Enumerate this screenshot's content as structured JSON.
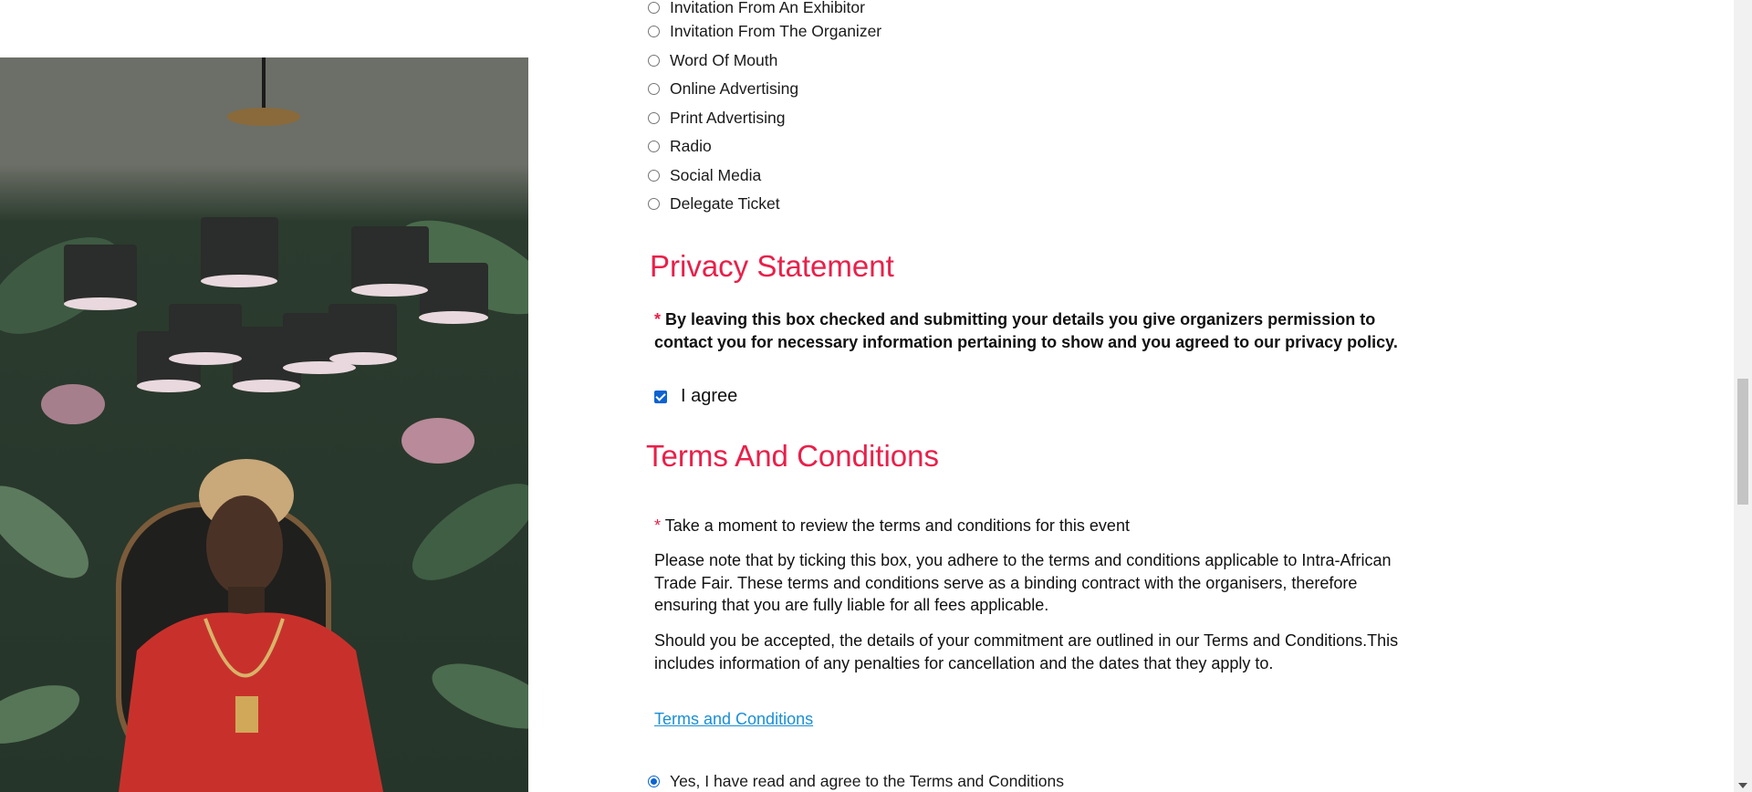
{
  "survey": {
    "options": [
      {
        "label": "Invitation From An Exhibitor",
        "checked": false
      },
      {
        "label": "Invitation From The Organizer",
        "checked": false
      },
      {
        "label": "Word Of Mouth",
        "checked": false
      },
      {
        "label": "Online Advertising",
        "checked": false
      },
      {
        "label": "Print Advertising",
        "checked": false
      },
      {
        "label": "Radio",
        "checked": false
      },
      {
        "label": "Social Media",
        "checked": false
      },
      {
        "label": "Delegate Ticket",
        "checked": false
      }
    ]
  },
  "privacy": {
    "title": "Privacy Statement",
    "required_mark": "*",
    "statement": "By leaving this box checked and submitting your details you give organizers permission to contact you for necessary information pertaining to show and you agreed to our privacy policy.",
    "agree_label": "I agree",
    "agree_checked": true
  },
  "terms": {
    "title": "Terms And Conditions",
    "required_mark": "*",
    "prompt": "Take a moment to review the terms and conditions for this event",
    "paragraph1": "Please note that by ticking this box, you adhere to the terms and conditions applicable to Intra-African Trade Fair. These terms and conditions serve as a binding contract with the organisers, therefore ensuring that you are fully liable for all fees applicable.",
    "paragraph2": "Should you be accepted, the details of your commitment are outlined in our Terms and Conditions.This includes information of any penalties for cancellation and the dates that they apply to.",
    "link_label": "Terms and Conditions",
    "accept_label": "Yes, I have read and agree to the Terms and Conditions",
    "accept_checked": true
  },
  "colors": {
    "accent": "#e8204a",
    "link": "#1a8fd6",
    "control": "#0b63d1"
  }
}
